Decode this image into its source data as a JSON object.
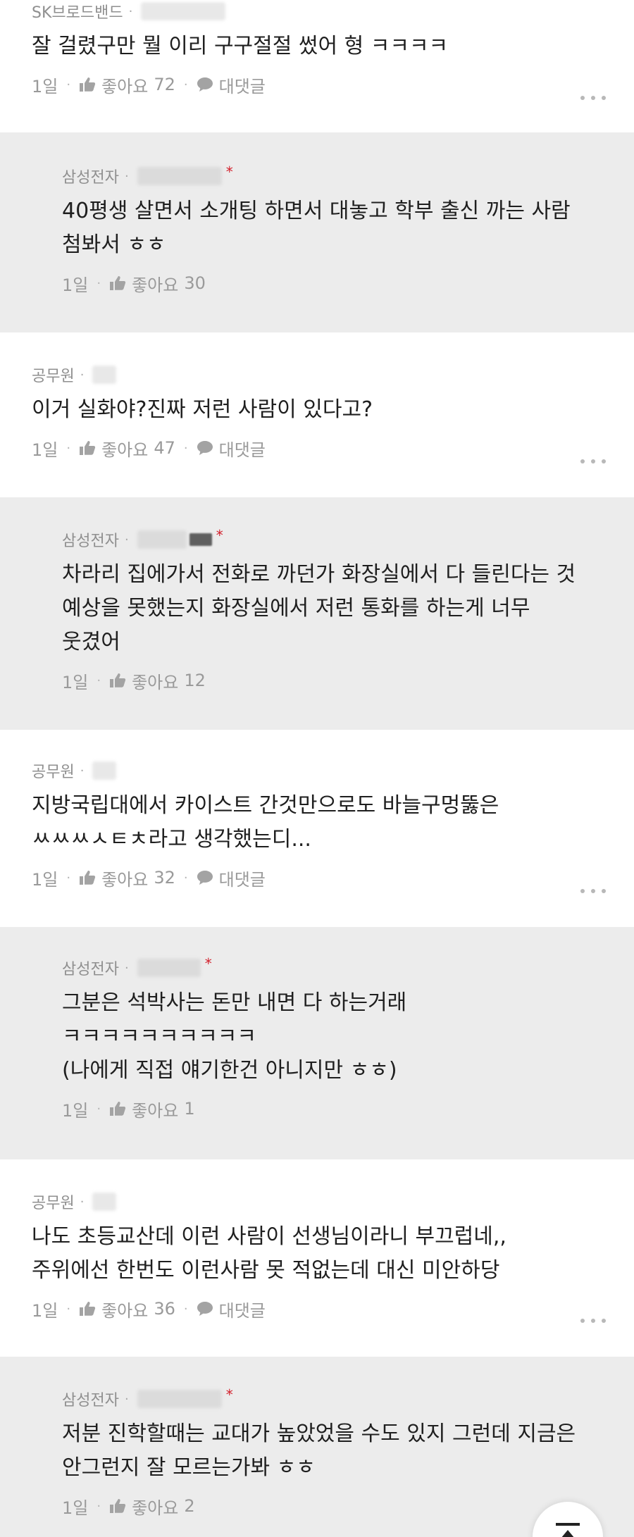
{
  "labels": {
    "like": "좋아요",
    "reply": "대댓글"
  },
  "comments": [
    {
      "author": "SK브로드밴드",
      "body": "잘 걸렸구만 뭘 이리 구구절절 썼어 형 ㅋㅋㅋㅋ",
      "time": "1일",
      "likes": "72"
    },
    {
      "author": "삼성전자",
      "body": "40평생 살면서 소개팅 하면서 대놓고 학부 출신 까는 사람\n첨봐서 ㅎㅎ",
      "time": "1일",
      "likes": "30"
    },
    {
      "author": "공무원",
      "body": "이거 실화야?진짜 저런 사람이 있다고?",
      "time": "1일",
      "likes": "47"
    },
    {
      "author": "삼성전자",
      "body": "차라리 집에가서 전화로 까던가 화장실에서 다 들린다는 것\n예상을 못했는지 화장실에서 저런 통화를 하는게 너무\n웃겼어",
      "time": "1일",
      "likes": "12"
    },
    {
      "author": "공무원",
      "body": "지방국립대에서 카이스트 간것만으로도 바늘구멍뚫은\nㅆㅆㅆㅅㅌㅊ라고 생각했는디...",
      "time": "1일",
      "likes": "32"
    },
    {
      "author": "삼성전자",
      "body": "그분은 석박사는 돈만 내면 다 하는거래\nㅋㅋㅋㅋㅋㅋㅋㅋㅋㅋ\n(나에게 직접 얘기한건 아니지만 ㅎㅎ)",
      "time": "1일",
      "likes": "1"
    },
    {
      "author": "공무원",
      "body": "나도 초등교산데 이런 사람이 선생님이라니 부끄럽네,,\n주위에선 한번도 이런사람 못 적없는데 대신 미안하당",
      "time": "1일",
      "likes": "36"
    },
    {
      "author": "삼성전자",
      "body": "저분 진학할때는 교대가 높았었을 수도 있지 그런데 지금은\n안그런지 잘 모르는가봐 ㅎㅎ",
      "time": "1일",
      "likes": "2"
    }
  ],
  "colors": {
    "reply_bg": "#ececec",
    "verified": "#d21f2b"
  },
  "icons": [
    "thumbs-up-icon",
    "speech-bubble-icon",
    "more-icon",
    "scroll-to-top-icon"
  ]
}
